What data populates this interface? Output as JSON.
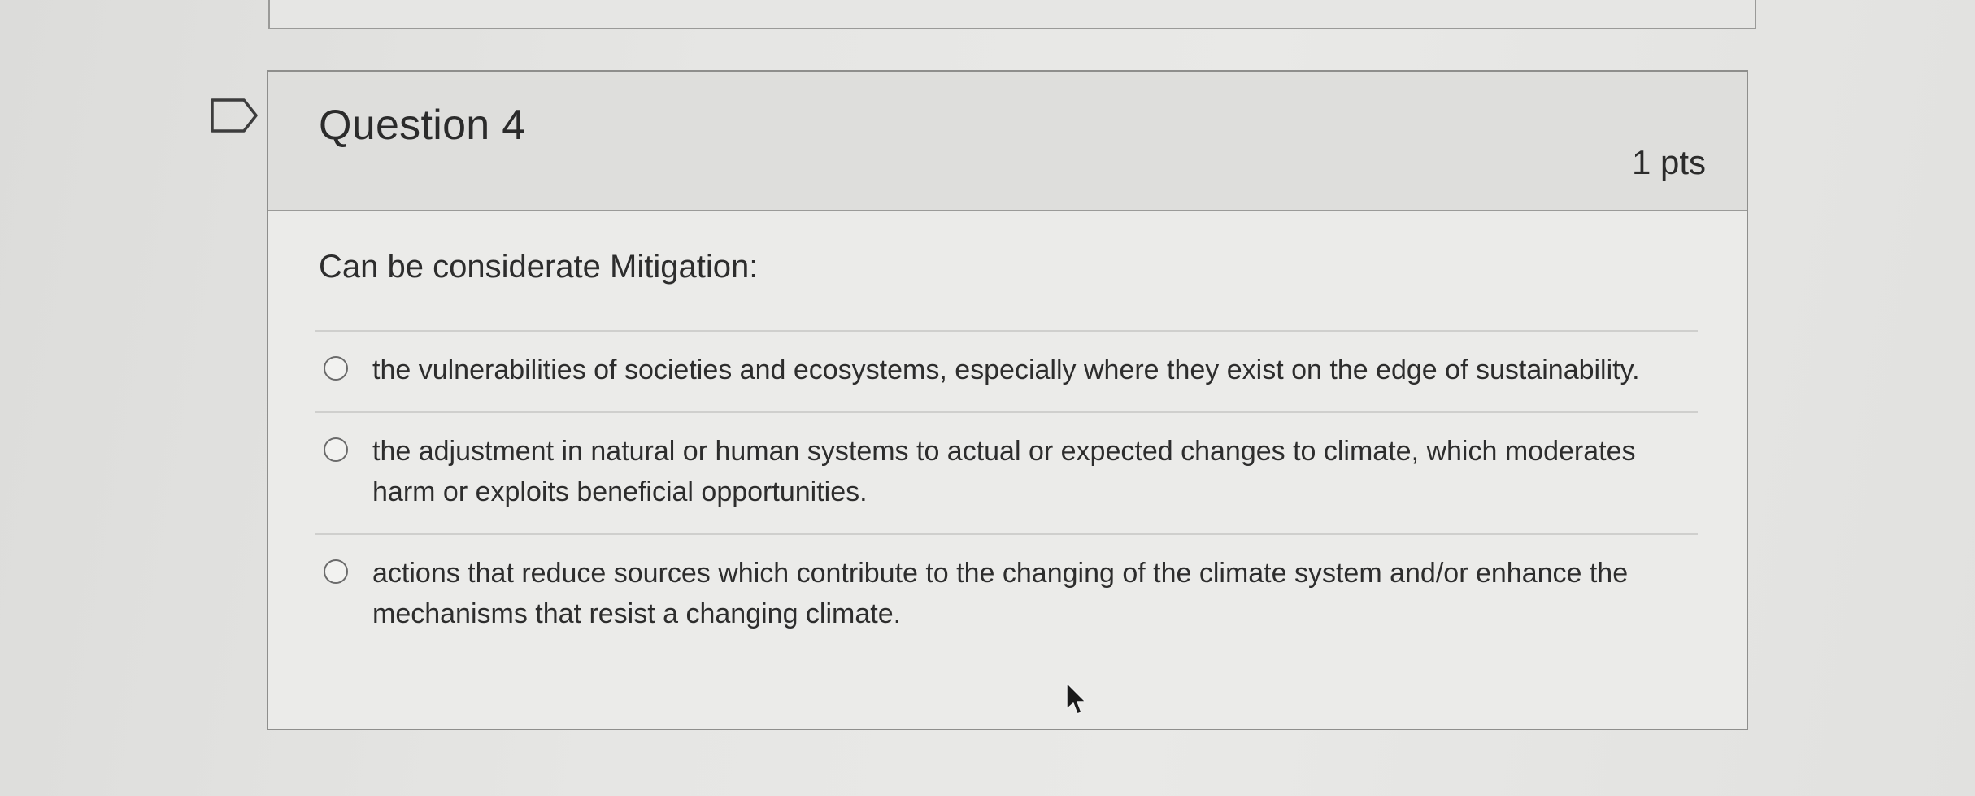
{
  "question": {
    "title": "Question 4",
    "points": "1 pts",
    "prompt": "Can be considerate Mitigation:",
    "answers": [
      {
        "label": "the vulnerabilities of societies and ecosystems, especially where they exist on the edge of sustainability."
      },
      {
        "label": "the adjustment in natural or human systems to actual or expected changes to climate, which moderates harm or exploits beneficial opportunities."
      },
      {
        "label": "actions that reduce sources which contribute to the changing of the climate system and/or enhance the mechanisms that resist a changing climate."
      }
    ]
  },
  "icons": {
    "flag": "flag-question-icon",
    "cursor": "mouse-pointer-icon"
  },
  "colors": {
    "background": "#e6e6e4",
    "header": "#dededc",
    "text": "#2d2d2d"
  }
}
